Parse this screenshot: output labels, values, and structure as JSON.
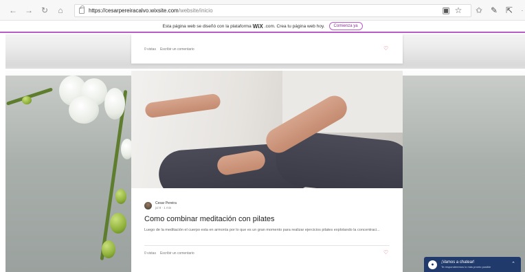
{
  "browser": {
    "url_main": "https://cesarpereiracalvo.wixsite.com",
    "url_rest": "/website/inicio",
    "icons": [
      "back-icon",
      "forward-icon",
      "refresh-icon",
      "home-icon",
      "lock-icon",
      "reading-view-icon",
      "favorite-star-icon",
      "favorites-icon",
      "pen-icon",
      "share-icon"
    ]
  },
  "banner": {
    "text_before": "Esta página web se diseñó con la plataforma",
    "brand": "WiX",
    "text_after": ".com. Crea tu página web hoy.",
    "cta": "Comienza ya",
    "accent_color": "#b85bc7"
  },
  "card_top": {
    "views": "0 vistas",
    "comment_link": "Escribir un comentario"
  },
  "post": {
    "author": "Cesar Pereira",
    "date": "jul 8",
    "read_time": "1 min",
    "title": "Como combinar meditación con pilates",
    "excerpt": "Luego de la meditación el cuerpo esta en armonía por lo que es un gran momento para realizar ejercicios pilates explotando la concentraci...",
    "views": "0 vistas",
    "comment_link": "Escribir un comentario"
  },
  "chat": {
    "title": "¡Vamos a chatear!",
    "subtitle": "Te responderemos lo más pronto posible",
    "color": "#1f3a6b"
  }
}
